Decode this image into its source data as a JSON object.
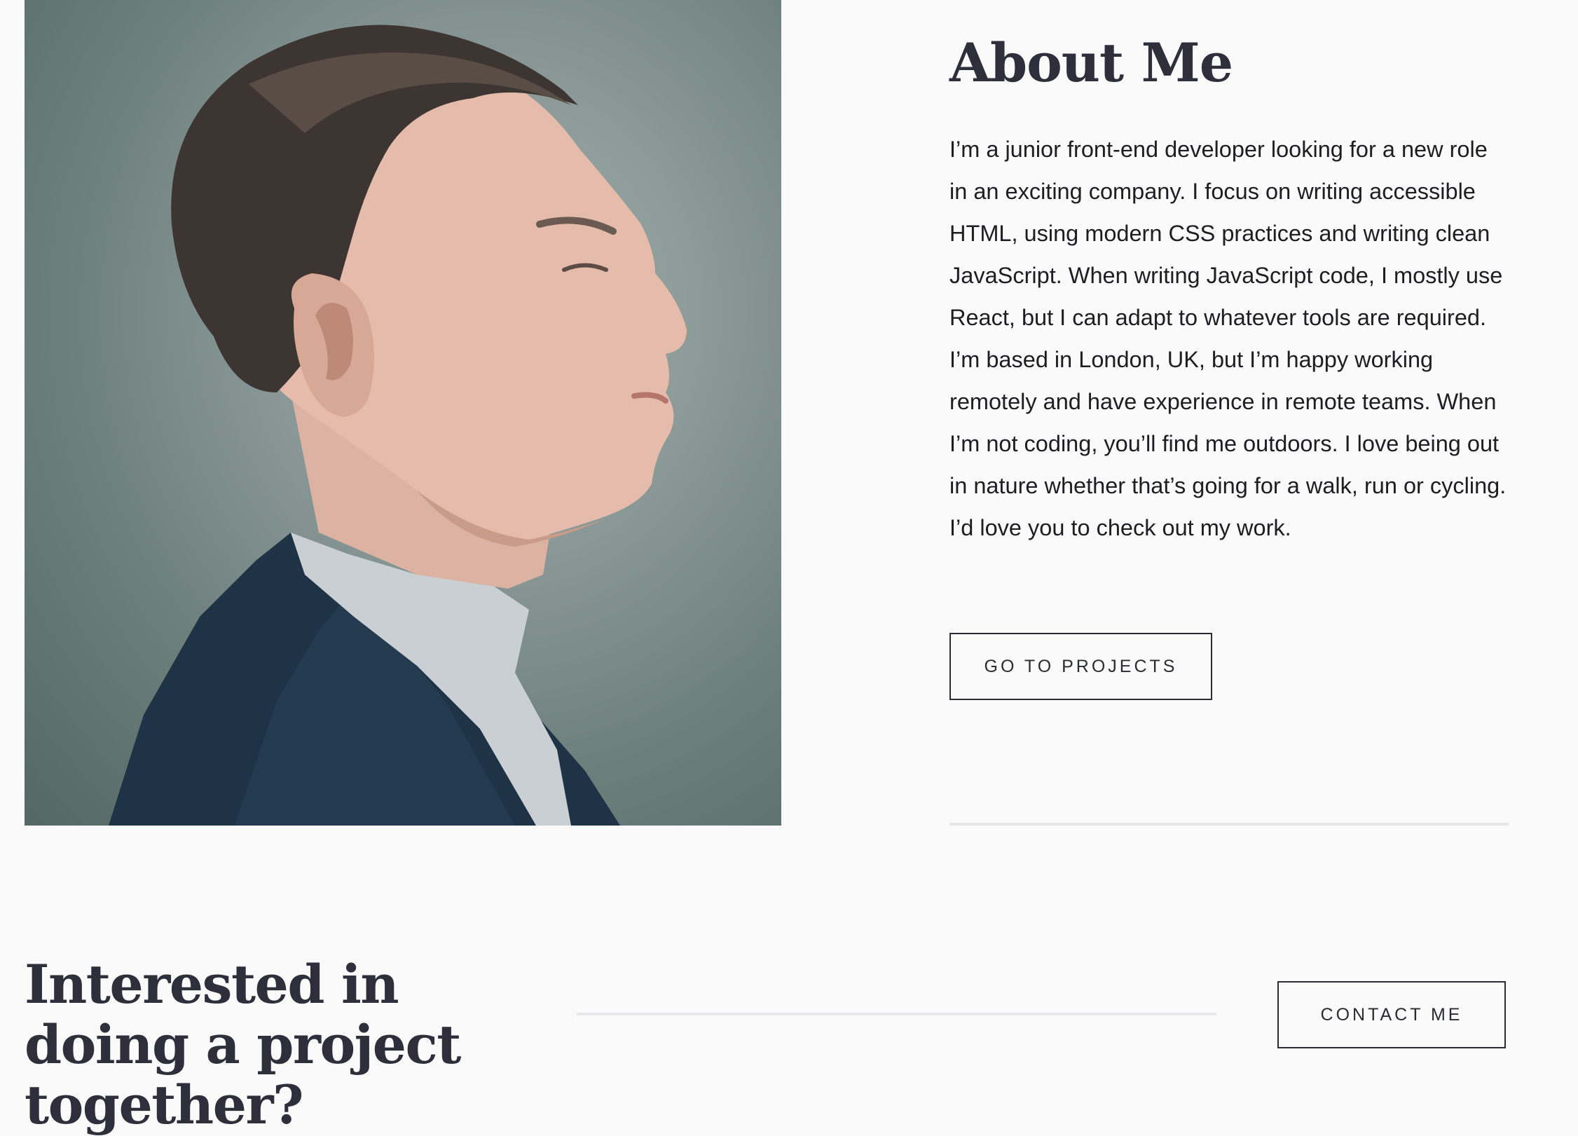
{
  "about": {
    "heading": "About Me",
    "paragraph": "I’m a junior front-end developer looking for a new role in an exciting company. I focus on writing accessible HTML, using modern CSS practices and writing clean JavaScript. When writing JavaScript code, I mostly use React, but I can adapt to whatever tools are required. I’m based in London, UK, but I’m happy working remotely and have experience in remote teams. When I’m not coding, you’ll find me outdoors. I love being out in nature whether that’s going for a walk, run or cycling. I’d love you to check out my work.",
    "button_label": "GO TO PROJECTS"
  },
  "contact": {
    "heading": "Interested in doing a project together?",
    "button_label": "CONTACT ME"
  },
  "colors": {
    "background": "#fafafa",
    "heading": "#2e2f3a",
    "text": "#1d1d22",
    "divider": "#e6e6e8",
    "button_border": "#2a2b33"
  }
}
